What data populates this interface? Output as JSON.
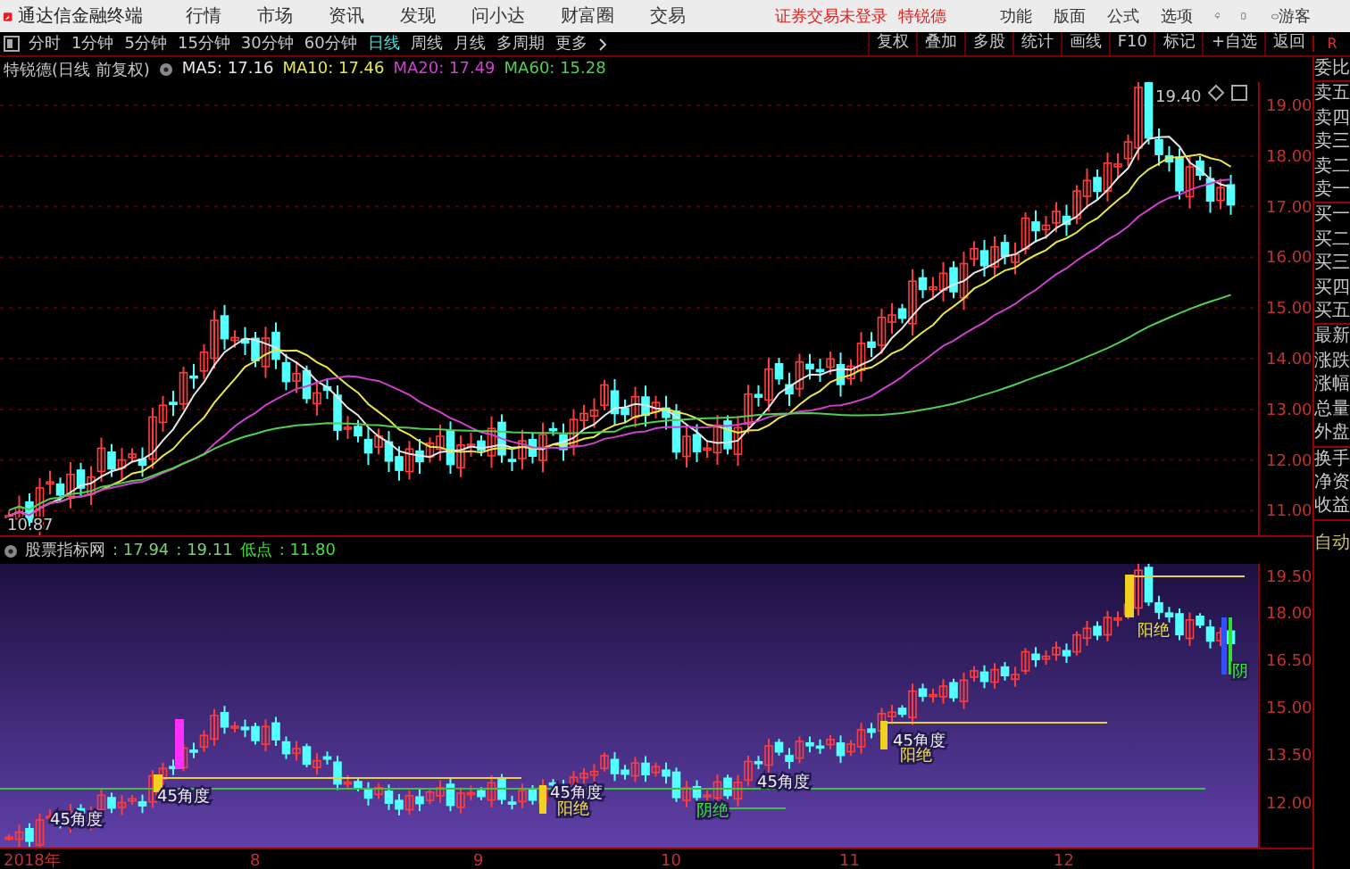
{
  "app": {
    "name": "通达信金融终端",
    "menu": [
      "行情",
      "市场",
      "资讯",
      "发现",
      "问小达",
      "财富圈",
      "交易"
    ],
    "notice": "证券交易未登录",
    "stock_link": "特锐德",
    "tools": [
      "功能",
      "版面",
      "公式",
      "选项"
    ],
    "user": "游客"
  },
  "periods": [
    {
      "label": "分时",
      "selected": false
    },
    {
      "label": "1分钟",
      "selected": false
    },
    {
      "label": "5分钟",
      "selected": false
    },
    {
      "label": "15分钟",
      "selected": false
    },
    {
      "label": "30分钟",
      "selected": false
    },
    {
      "label": "60分钟",
      "selected": false
    },
    {
      "label": "日线",
      "selected": true
    },
    {
      "label": "周线",
      "selected": false
    },
    {
      "label": "月线",
      "selected": false
    },
    {
      "label": "多周期",
      "selected": false
    }
  ],
  "more": "更多",
  "actions": [
    "复权",
    "叠加",
    "多股",
    "统计",
    "画线",
    "F10",
    "标记",
    "+自选",
    "返回"
  ],
  "corner": "R",
  "main_chart": {
    "title": "特锐德(日线 前复权)",
    "ma": [
      {
        "label": "MA5: 17.16",
        "color": "#e8e8e8"
      },
      {
        "label": "MA10: 17.46",
        "color": "#e8e84a"
      },
      {
        "label": "MA20: 17.49",
        "color": "#d040d0"
      },
      {
        "label": "MA60: 15.28",
        "color": "#50d050"
      }
    ],
    "y_labels": [
      "19.00",
      "18.00",
      "17.00",
      "16.00",
      "15.00",
      "14.00",
      "13.00",
      "12.00",
      "11.00"
    ],
    "high_label": "19.40",
    "low_label": "10.87"
  },
  "quote_groups": [
    [
      "委比"
    ],
    [
      "卖五",
      "卖四",
      "卖三",
      "卖二",
      "卖一"
    ],
    [
      "买一",
      "买二",
      "买三",
      "买四",
      "买五"
    ],
    [
      "最新",
      "涨跌",
      "涨幅",
      "总量",
      "外盘"
    ],
    [
      "换手",
      "净资",
      "收益"
    ]
  ],
  "indicator": {
    "name": "股票指标网",
    "values": [
      ": 17.94",
      ": 19.11"
    ],
    "low_label": "低点",
    "low_value": ": 11.80",
    "auto": "自动",
    "y_labels": [
      "19.50",
      "18.00",
      "16.50",
      "15.00",
      "13.50",
      "12.00"
    ],
    "annotations": [
      {
        "kind": "angle",
        "text": "45角度"
      },
      {
        "kind": "angle",
        "text": "45角度"
      },
      {
        "kind": "angle",
        "text": "45角度"
      },
      {
        "kind": "yang",
        "text": "阳绝"
      },
      {
        "kind": "yin",
        "text": "阴绝"
      },
      {
        "kind": "angle",
        "text": "45角度"
      },
      {
        "kind": "angle",
        "text": "45角度"
      },
      {
        "kind": "yang",
        "text": "阳绝"
      },
      {
        "kind": "yang",
        "text": "阳绝"
      },
      {
        "kind": "yin",
        "text": "阴"
      }
    ]
  },
  "x_labels": [
    "2018年",
    "8",
    "9",
    "10",
    "11",
    "12"
  ]
}
